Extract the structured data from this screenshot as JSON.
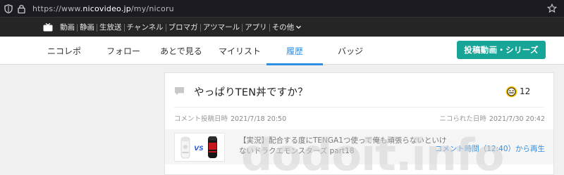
{
  "browser": {
    "url_prefix": "https://www.",
    "url_domain": "nicovideo.jp",
    "url_path": "/my/nicoru"
  },
  "topbar": {
    "links": [
      "動画",
      "静画",
      "生放送",
      "チャンネル",
      "ブロマガ",
      "アツマール",
      "アプリ",
      "その他"
    ]
  },
  "tabs": [
    {
      "label": "ニコレポ",
      "active": false
    },
    {
      "label": "フォロー",
      "active": false
    },
    {
      "label": "あとで見る",
      "active": false
    },
    {
      "label": "マイリスト",
      "active": false
    },
    {
      "label": "履歴",
      "active": true
    },
    {
      "label": "バッジ",
      "active": false
    }
  ],
  "post_button": "投稿動画・シリーズ",
  "card": {
    "comment": "やっぱりTEN丼ですか？",
    "nicoru_count": "12",
    "posted_label": "コメント投稿日時",
    "posted_date": "2021/7/18 20:50",
    "nicoru_label": "ニコられた日時",
    "nicoru_date": "2021/7/30 20:42",
    "thumbnail_vs": "VS",
    "video_title": "【実況】配合する度にTENGA1つ使って俺も頑張らないといけないドラクエモンスターズ part18",
    "play_link": "コメント時間（12:40）から再生"
  },
  "watermark": "dodoit.info",
  "colors": {
    "accent": "#2f8fe3",
    "post_button": "#16a596",
    "topbar": "#252525"
  }
}
